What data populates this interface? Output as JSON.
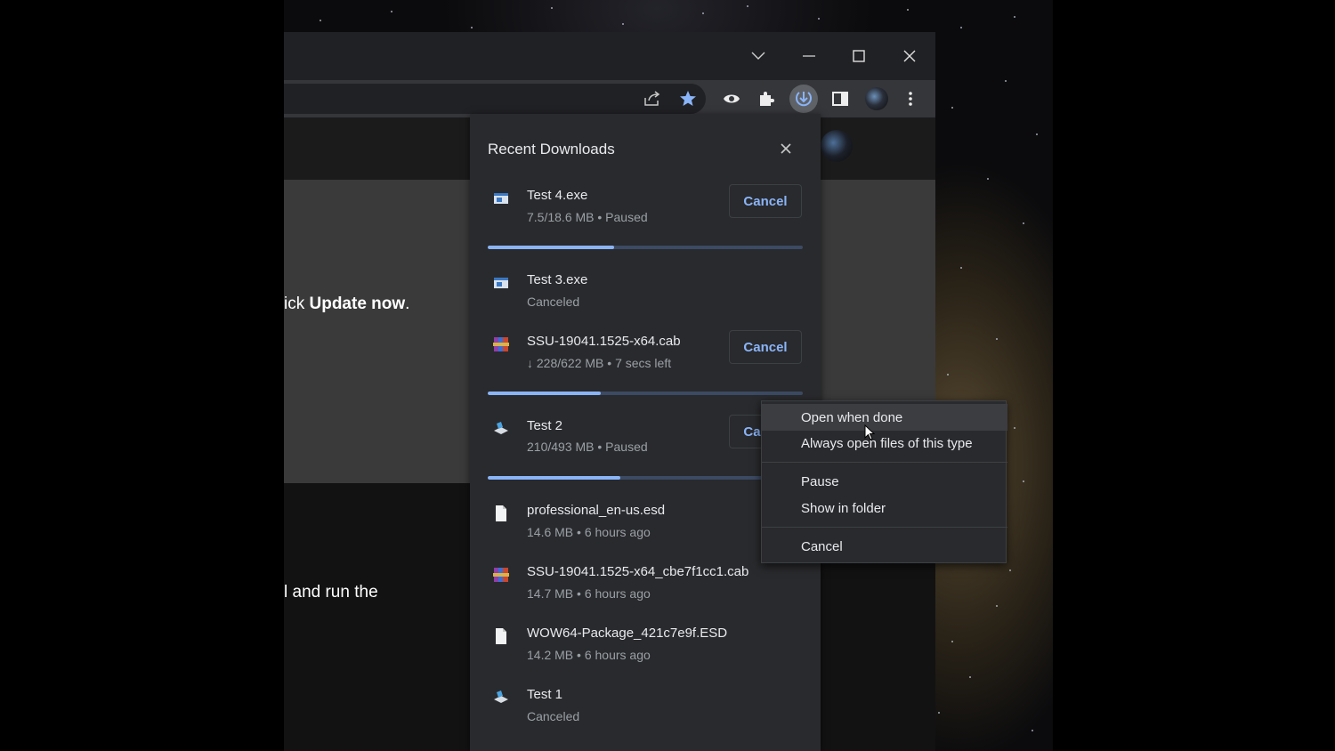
{
  "window": {
    "tab_search_icon": "chevron-down-icon",
    "minimize_icon": "minimize-icon",
    "maximize_icon": "maximize-icon",
    "close_icon": "close-icon"
  },
  "toolbar": {
    "icons": [
      "share-icon",
      "star-icon",
      "eye-icon",
      "extensions-icon",
      "download-icon",
      "side-panel-icon",
      "avatar",
      "menu-icon"
    ],
    "accent": "#8ab4f8"
  },
  "page": {
    "line1_prefix": "ick ",
    "line1_bold": "Update now",
    "line1_suffix": ".",
    "line2": "l and run the"
  },
  "downloads": {
    "title": "Recent Downloads",
    "items": [
      {
        "name": "Test 4.exe",
        "status": "7.5/18.6 MB • Paused",
        "icon": "exe-icon",
        "action": "Cancel",
        "progress": 0.4
      },
      {
        "name": "Test 3.exe",
        "status": "Canceled",
        "icon": "exe-icon"
      },
      {
        "name": "SSU-19041.1525-x64.cab",
        "status": "↓ 228/622 MB • 7 secs left",
        "icon": "archive-icon",
        "action": "Cancel",
        "progress": 0.36
      },
      {
        "name": "Test 2",
        "status": "210/493 MB • Paused",
        "icon": "installer-icon",
        "action": "Cancel",
        "progress": 0.42
      },
      {
        "name": "professional_en-us.esd",
        "status": "14.6 MB • 6 hours ago",
        "icon": "file-icon"
      },
      {
        "name": "SSU-19041.1525-x64_cbe7f1cc1.cab",
        "status": "14.7 MB • 6 hours ago",
        "icon": "archive-icon"
      },
      {
        "name": "WOW64-Package_421c7e9f.ESD",
        "status": "14.2 MB • 6 hours ago",
        "icon": "file-icon"
      },
      {
        "name": "Test 1",
        "status": "Canceled",
        "icon": "installer-icon"
      }
    ]
  },
  "context_menu": {
    "items": [
      "Open when done",
      "Always open files of this type",
      "Pause",
      "Show in folder",
      "Cancel"
    ]
  }
}
